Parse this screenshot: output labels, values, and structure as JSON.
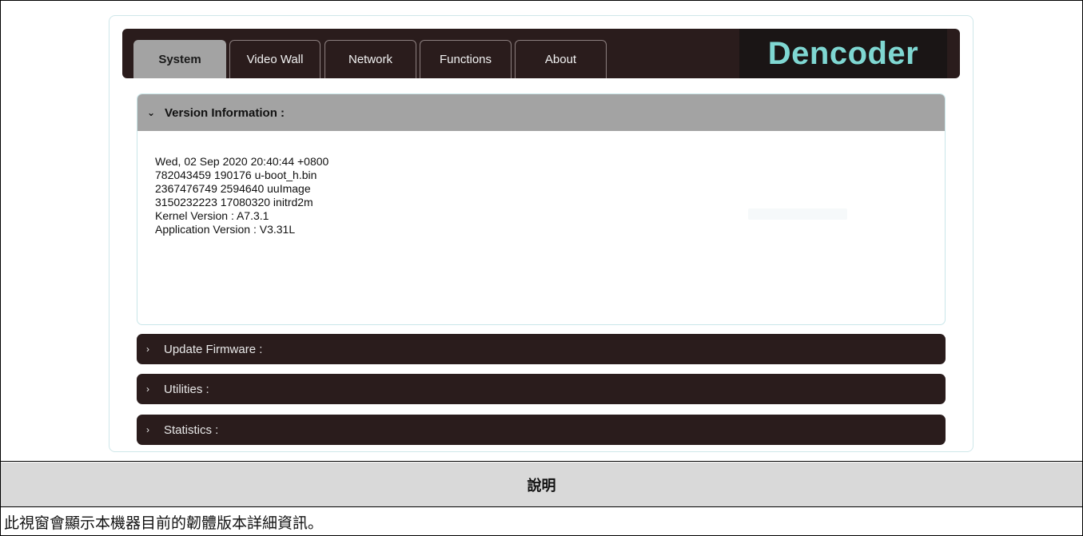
{
  "brand": "Dencoder",
  "tabs": [
    {
      "label": "System",
      "active": true
    },
    {
      "label": "Video Wall",
      "active": false
    },
    {
      "label": "Network",
      "active": false
    },
    {
      "label": "Functions",
      "active": false
    },
    {
      "label": "About",
      "active": false
    }
  ],
  "sections": {
    "version": {
      "title": "Version Information :",
      "expanded": true,
      "lines": [
        "Wed, 02 Sep 2020 20:40:44 +0800",
        "782043459 190176 u-boot_h.bin",
        "2367476749 2594640 uuImage",
        "3150232223 17080320 initrd2m",
        "Kernel Version : A7.3.1",
        "Application Version : V3.31L"
      ]
    },
    "update_firmware": {
      "title": "Update Firmware :",
      "expanded": false
    },
    "utilities": {
      "title": "Utilities :",
      "expanded": false
    },
    "statistics": {
      "title": "Statistics :",
      "expanded": false
    }
  },
  "icons": {
    "expanded": "chevron-down-icon",
    "collapsed": "chevron-right-icon"
  },
  "colors": {
    "tab_bar": "#2a1c1c",
    "active_tab": "#a3a3a3",
    "brand_text": "#7fd7d2",
    "caption_header_bg": "#d9d9d9"
  },
  "caption": {
    "header": "說明",
    "body": "此視窗會顯示本機器目前的韌體版本詳細資訊。"
  }
}
